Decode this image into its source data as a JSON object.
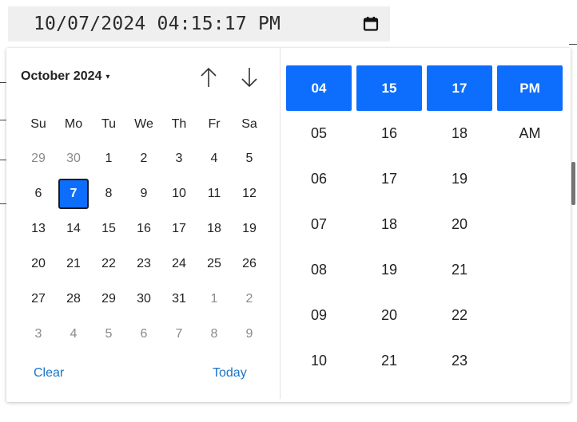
{
  "input": {
    "value": "10/07/2024 04:15:17 PM",
    "icon": "calendar-icon"
  },
  "calendar": {
    "month_label": "October 2024",
    "caret": "▾",
    "weekdays": [
      "Su",
      "Mo",
      "Tu",
      "We",
      "Th",
      "Fr",
      "Sa"
    ],
    "days": [
      {
        "d": "29",
        "muted": true
      },
      {
        "d": "30",
        "muted": true
      },
      {
        "d": "1"
      },
      {
        "d": "2"
      },
      {
        "d": "3"
      },
      {
        "d": "4"
      },
      {
        "d": "5"
      },
      {
        "d": "6"
      },
      {
        "d": "7",
        "selected": true
      },
      {
        "d": "8"
      },
      {
        "d": "9"
      },
      {
        "d": "10"
      },
      {
        "d": "11"
      },
      {
        "d": "12"
      },
      {
        "d": "13"
      },
      {
        "d": "14"
      },
      {
        "d": "15"
      },
      {
        "d": "16"
      },
      {
        "d": "17"
      },
      {
        "d": "18"
      },
      {
        "d": "19"
      },
      {
        "d": "20"
      },
      {
        "d": "21"
      },
      {
        "d": "22"
      },
      {
        "d": "23"
      },
      {
        "d": "24"
      },
      {
        "d": "25"
      },
      {
        "d": "26"
      },
      {
        "d": "27"
      },
      {
        "d": "28"
      },
      {
        "d": "29"
      },
      {
        "d": "30"
      },
      {
        "d": "31"
      },
      {
        "d": "1",
        "muted": true
      },
      {
        "d": "2",
        "muted": true
      },
      {
        "d": "3",
        "muted": true
      },
      {
        "d": "4",
        "muted": true
      },
      {
        "d": "5",
        "muted": true
      },
      {
        "d": "6",
        "muted": true
      },
      {
        "d": "7",
        "muted": true
      },
      {
        "d": "8",
        "muted": true
      },
      {
        "d": "9",
        "muted": true
      }
    ],
    "clear_label": "Clear",
    "today_label": "Today"
  },
  "time": {
    "hours": [
      "04",
      "05",
      "06",
      "07",
      "08",
      "09",
      "10"
    ],
    "minutes": [
      "15",
      "16",
      "17",
      "18",
      "19",
      "20",
      "21"
    ],
    "seconds": [
      "17",
      "18",
      "19",
      "20",
      "21",
      "22",
      "23"
    ],
    "meridiem": [
      "PM",
      "AM"
    ],
    "selected": {
      "hour": "04",
      "minute": "15",
      "second": "17",
      "meridiem": "PM"
    }
  },
  "colors": {
    "accent": "#0d6efd",
    "link": "#1a73c8",
    "input_bg": "#efefef"
  }
}
